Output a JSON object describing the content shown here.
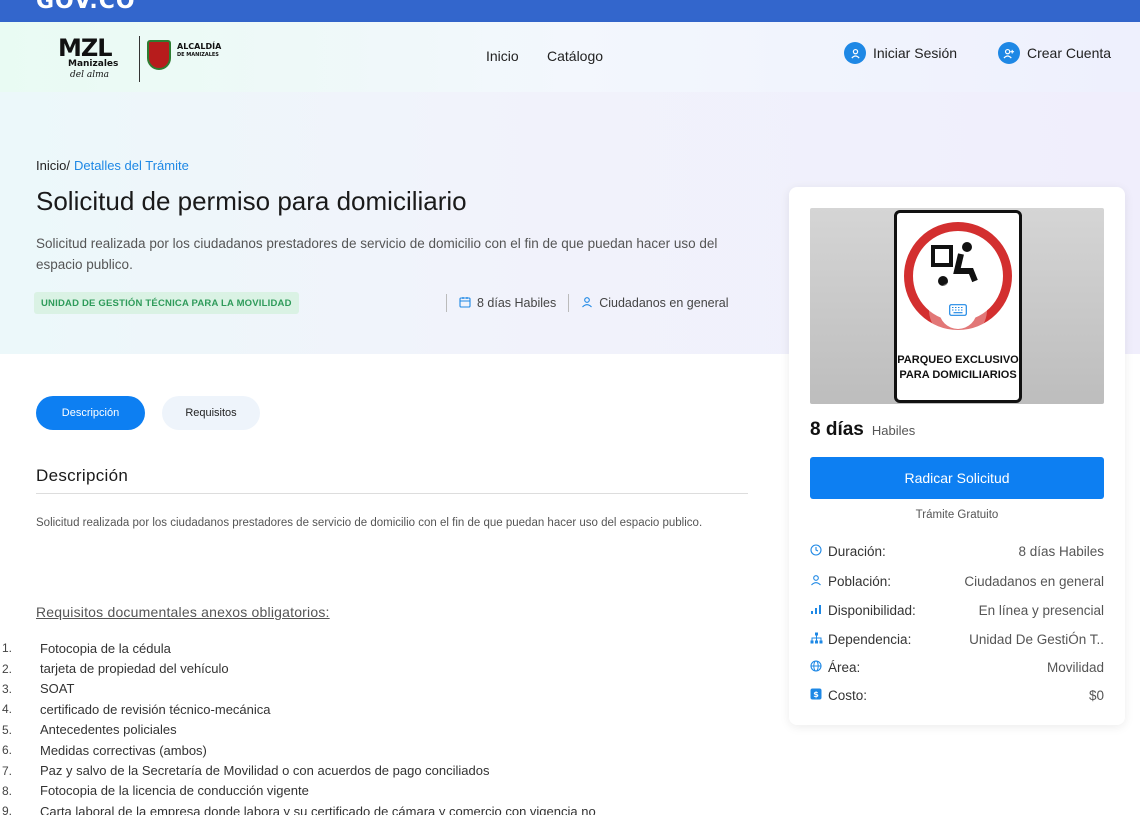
{
  "gov_bar": {
    "text": "GOV.CO"
  },
  "header": {
    "logo": {
      "line1": "MZL",
      "line2": "Manizales",
      "line3": "del alma"
    },
    "alcaldia": {
      "line1": "ALCALDÍA",
      "line2": "DE MANIZALES"
    },
    "nav": [
      {
        "label": "Inicio"
      },
      {
        "label": "Catálogo"
      }
    ],
    "login_label": "Iniciar Sesión",
    "register_label": "Crear Cuenta"
  },
  "breadcrumb": {
    "home": "Inicio/",
    "current": "Detalles del Trámite"
  },
  "title": "Solicitud de permiso para domiciliario",
  "description": "Solicitud realizada por los ciudadanos prestadores de servicio de domicilio con el fin de que puedan hacer uso del espacio publico.",
  "unit_badge": "UNIDAD DE GESTIÓN TÉCNICA PARA LA MOVILIDAD",
  "meta": {
    "duration": "8 días Habiles",
    "population": "Ciudadanos en general"
  },
  "tabs": [
    {
      "label": "Descripción"
    },
    {
      "label": "Requisitos"
    }
  ],
  "section": {
    "title": "Descripción",
    "body": "Solicitud realizada por los ciudadanos prestadores de servicio de domicilio con el fin de que puedan hacer uso del espacio publico."
  },
  "requirements": {
    "title": "Requisitos documentales anexos obligatorios:",
    "items": [
      {
        "num": "1.",
        "text": "Fotocopia de la cédula"
      },
      {
        "num": "2.",
        "text": "tarjeta de propiedad del vehículo"
      },
      {
        "num": "3.",
        "text": "SOAT"
      },
      {
        "num": "4.",
        "text": "certificado de revisión técnico-mecánica"
      },
      {
        "num": "5.",
        "text": "Antecedentes policiales"
      },
      {
        "num": "6.",
        "text": "Medidas correctivas (ambos)"
      },
      {
        "num": "7.",
        "text": "Paz y salvo de la Secretaría de Movilidad o con acuerdos de pago conciliados"
      },
      {
        "num": "8.",
        "text": "Fotocopia de la licencia de conducción vigente"
      },
      {
        "num": "9.",
        "text": "Carta laboral de la empresa donde labora y su certificado de cámara y comercio con vigencia no"
      }
    ]
  },
  "card": {
    "image_text": {
      "line1": "PARQUEO EXCLUSIVO",
      "line2": "PARA DOMICILIARIOS"
    },
    "days_big": "8 días",
    "days_small": "Habiles",
    "cta_label": "Radicar Solicitud",
    "free_label": "Trámite Gratuito",
    "info": [
      {
        "icon": "clock-icon",
        "label": "Duración:",
        "value": "8 días Habiles"
      },
      {
        "icon": "user-icon",
        "label": "Población:",
        "value": "Ciudadanos en general"
      },
      {
        "icon": "signal-icon",
        "label": "Disponibilidad:",
        "value": "En línea y presencial"
      },
      {
        "icon": "org-chart-icon",
        "label": "Dependencia:",
        "value": "Unidad De GestiÓn T.."
      },
      {
        "icon": "globe-icon",
        "label": "Área:",
        "value": "Movilidad"
      },
      {
        "icon": "money-icon",
        "label": "Costo:",
        "value": "$0"
      }
    ]
  },
  "colors": {
    "primary": "#0d7ff2",
    "gov_blue": "#3366cc",
    "badge_bg": "#daf2e4",
    "badge_text": "#2e9b5a"
  }
}
